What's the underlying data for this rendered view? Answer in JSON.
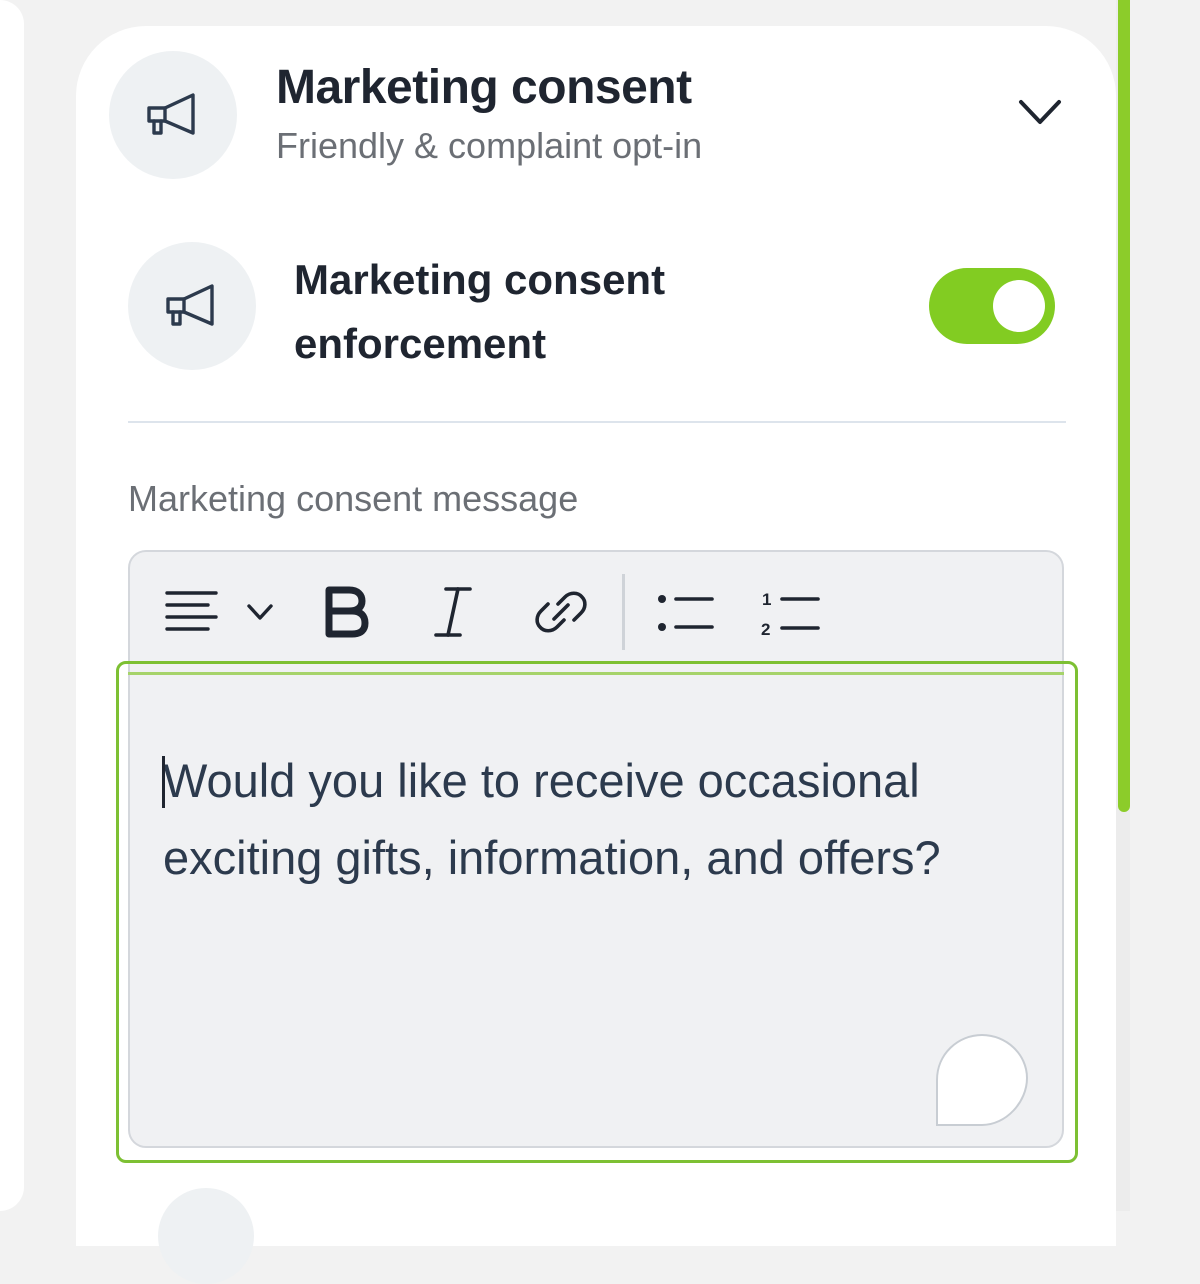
{
  "header": {
    "icon": "megaphone-icon",
    "title": "Marketing consent",
    "subtitle": "Friendly & complaint opt-in",
    "expand_icon": "chevron-down-icon"
  },
  "enforcement": {
    "icon": "megaphone-icon",
    "label": "Marketing consent enforcement",
    "toggle_on": true
  },
  "message_field": {
    "label": "Marketing consent message",
    "toolbar": [
      "align-left-icon",
      "chevron-down-icon",
      "bold-icon",
      "italic-icon",
      "link-icon",
      "bullet-list-icon",
      "numbered-list-icon"
    ],
    "value": "Would you like to receive occasional exciting gifts, information, and offers?",
    "chat_icon": "chat-bubble-icon"
  },
  "colors": {
    "accent": "#82cc22",
    "focus_border": "#7dc033",
    "title_text": "#1f2530",
    "muted_text": "#6b6f75",
    "icon_bg": "#eef1f3"
  }
}
